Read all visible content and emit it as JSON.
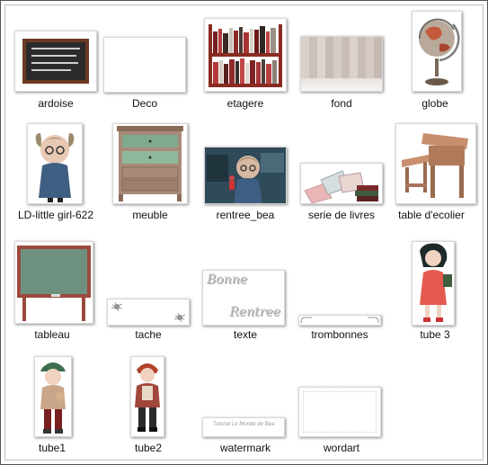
{
  "folder": {
    "items": [
      {
        "name": "ardoise",
        "icon": "chalkboard-slate-icon"
      },
      {
        "name": "Deco",
        "icon": "blank-image-icon"
      },
      {
        "name": "etagere",
        "icon": "bookshelf-icon"
      },
      {
        "name": "fond",
        "icon": "wood-floor-background-icon"
      },
      {
        "name": "globe",
        "icon": "globe-icon"
      },
      {
        "name": "LD-little girl-622",
        "icon": "little-girl-tube-icon"
      },
      {
        "name": "meuble",
        "icon": "dresser-icon"
      },
      {
        "name": "rentree_bea",
        "icon": "classroom-scene-icon"
      },
      {
        "name": "serie de livres",
        "icon": "books-stack-icon"
      },
      {
        "name": "table d'ecolier",
        "icon": "school-desk-icon"
      },
      {
        "name": "tableau",
        "icon": "green-chalkboard-icon"
      },
      {
        "name": "tache",
        "icon": "ink-stain-icon"
      },
      {
        "name": "texte",
        "icon": "bonne-rentree-text-icon"
      },
      {
        "name": "trombonnes",
        "icon": "paper-clips-icon"
      },
      {
        "name": "tube 3",
        "icon": "girl-red-coat-icon"
      },
      {
        "name": "tube1",
        "icon": "boy-green-cap-icon"
      },
      {
        "name": "tube2",
        "icon": "boy-red-hair-icon"
      },
      {
        "name": "watermark",
        "icon": "watermark-icon"
      },
      {
        "name": "wordart",
        "icon": "wordart-frame-icon"
      }
    ]
  },
  "thumb_text": {
    "texte_line1": "Bonne",
    "texte_line2": "Rentree",
    "watermark_text": "Tutoriel Le Monde de Bea"
  }
}
